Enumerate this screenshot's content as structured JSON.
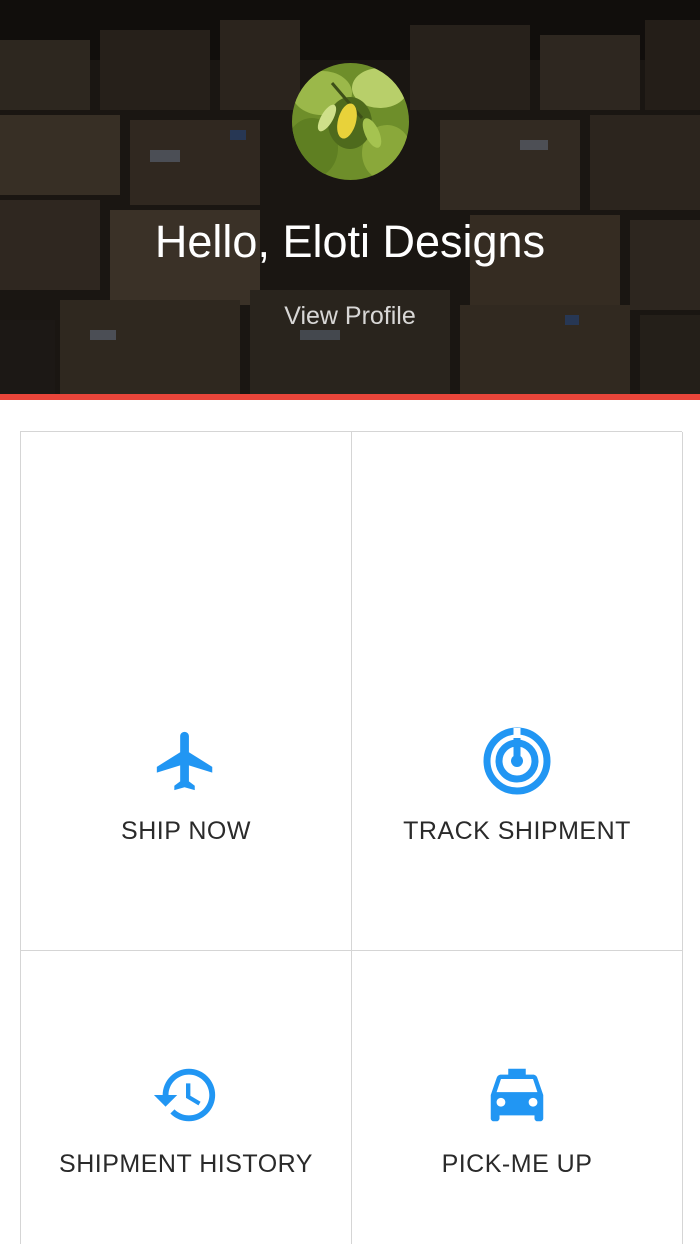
{
  "header": {
    "greeting": "Hello, Eloti Designs",
    "profile_link": "View Profile"
  },
  "menu": {
    "items": [
      {
        "label": "SHIP NOW",
        "icon": "airplane-icon"
      },
      {
        "label": "TRACK SHIPMENT",
        "icon": "radar-icon"
      },
      {
        "label": "SHIPMENT HISTORY",
        "icon": "history-icon"
      },
      {
        "label": "PICK-ME UP",
        "icon": "taxi-icon"
      }
    ]
  },
  "colors": {
    "accent": "#e9453a",
    "icon": "#2196f3",
    "label": "#2a2a2a"
  }
}
